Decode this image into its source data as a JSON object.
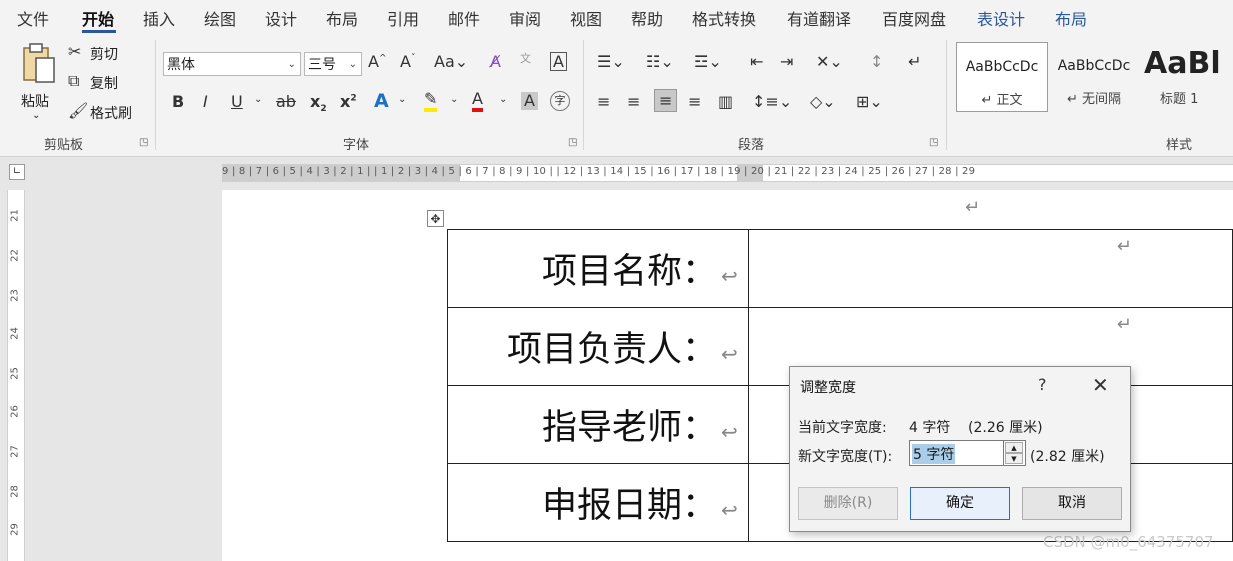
{
  "menu": {
    "items": [
      {
        "label": "文件"
      },
      {
        "label": "开始"
      },
      {
        "label": "插入"
      },
      {
        "label": "绘图"
      },
      {
        "label": "设计"
      },
      {
        "label": "布局"
      },
      {
        "label": "引用"
      },
      {
        "label": "邮件"
      },
      {
        "label": "审阅"
      },
      {
        "label": "视图"
      },
      {
        "label": "帮助"
      },
      {
        "label": "格式转换"
      },
      {
        "label": "有道翻译"
      },
      {
        "label": "百度网盘"
      },
      {
        "label": "表设计"
      },
      {
        "label": "布局"
      }
    ],
    "active": "开始"
  },
  "ribbon": {
    "clipboard": {
      "paste_label": "粘贴",
      "cut_label": "剪切",
      "copy_label": "复制",
      "format_painter_label": "格式刷",
      "group_label": "剪贴板"
    },
    "font": {
      "font_name": "黑体",
      "font_size": "三号",
      "group_label": "字体"
    },
    "paragraph": {
      "group_label": "段落"
    },
    "styles": {
      "group_label": "样式",
      "items": [
        {
          "preview": "AaBbCcDc",
          "name": "↵ 正文"
        },
        {
          "preview": "AaBbCcDc",
          "name": "↵ 无间隔"
        },
        {
          "preview": "AaBl",
          "name": "标题 1"
        }
      ]
    }
  },
  "ruler": {
    "horizontal": "9 | 8 | 7 | 6 | 5 | 4 | 3 | 2 | 1 |        | 1 | 2 | 3 | 4 | 5 | 6 | 7 | 8 | 9 | 10 |      | 12 | 13 | 14 | 15 | 16 | 17 | 18 | 19 | 20 | 21 | 22 | 23 | 24 | 25 | 26 | 27 | 28 | 29",
    "vertical": [
      "21",
      "22",
      "23",
      "24",
      "25",
      "26",
      "27",
      "28",
      "29"
    ]
  },
  "document": {
    "rows": [
      {
        "label": "项目名称："
      },
      {
        "label": "项目负责人："
      },
      {
        "label": "指导老师："
      },
      {
        "label": "申报日期："
      }
    ],
    "cell_mark": "↩",
    "para_mark": "↵"
  },
  "dialog": {
    "title": "调整宽度",
    "help": "?",
    "close": "✕",
    "current_label": "当前文字宽度:",
    "current_value": "4 字符",
    "current_cm": "(2.26 厘米)",
    "new_label": "新文字宽度(T):",
    "new_value": "5 字符",
    "new_cm": "(2.82 厘米)",
    "delete_button": "删除(R)",
    "ok_button": "确定",
    "cancel_button": "取消"
  },
  "watermark": "CSDN @m0_64375707"
}
